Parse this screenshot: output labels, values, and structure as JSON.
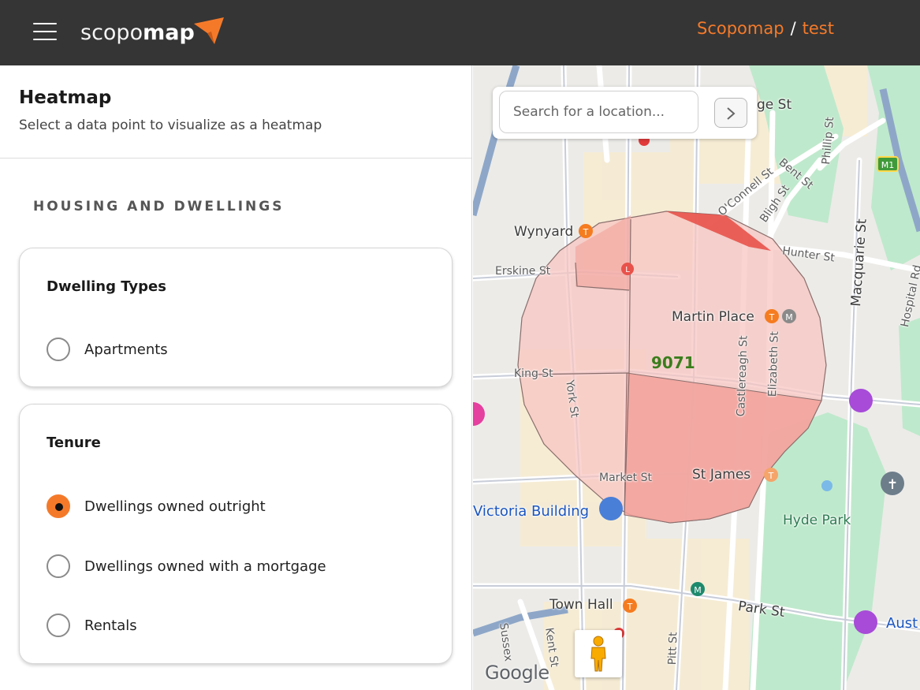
{
  "header": {
    "logo_light": "scopo",
    "logo_bold": "map",
    "breadcrumb_root": "Scopomap",
    "breadcrumb_separator": "/",
    "breadcrumb_current": "test",
    "accent_color": "#f47a2a",
    "bar_color": "#353535"
  },
  "sidebar": {
    "title": "Heatmap",
    "subtitle": "Select a data point to visualize as a heatmap",
    "section_title": "HOUSING AND DWELLINGS",
    "groups": [
      {
        "title": "Dwelling Types",
        "options": [
          {
            "label": "Apartments",
            "selected": false
          }
        ]
      },
      {
        "title": "Tenure",
        "options": [
          {
            "label": "Dwellings owned outright",
            "selected": true
          },
          {
            "label": "Dwellings owned with a mortgage",
            "selected": false
          },
          {
            "label": "Rentals",
            "selected": false
          }
        ]
      }
    ]
  },
  "map": {
    "search_placeholder": "Search for a location...",
    "heat_value": "9071",
    "attribution": "Google",
    "labels": {
      "wynyard": "Wynyard",
      "martin_place": "Martin Place",
      "st_james": "St James",
      "hyde_park": "Hyde Park",
      "town_hall": "Town Hall",
      "victoria_building": "Victoria Building",
      "erskine_st": "Erskine St",
      "king_st": "King St",
      "market_st": "Market St",
      "park_st": "Park St",
      "hunter_st": "Hunter St",
      "macquarie_st": "Macquarie St",
      "york_st": "York St",
      "castlereagh_st": "Castlereagh St",
      "elizabeth_st": "Elizabeth St",
      "oconnell_st": "O'Connell St",
      "bligh_st": "Bligh St",
      "bent_st": "Bent St",
      "phillip_st": "Phillip St",
      "pitt_st": "Pitt St",
      "kent_st": "Kent St",
      "sussex": "Sussex",
      "ge_st": "ge St",
      "hospital_rd": "Hospital Rd",
      "aust": "Aust",
      "m1": "M1"
    },
    "colors": {
      "heat_light": "#f7c6c2",
      "heat_medium": "#f2a19b",
      "heat_dark": "#e8524a",
      "park": "#bfe9cc",
      "commercial": "#f7ecd2"
    }
  }
}
